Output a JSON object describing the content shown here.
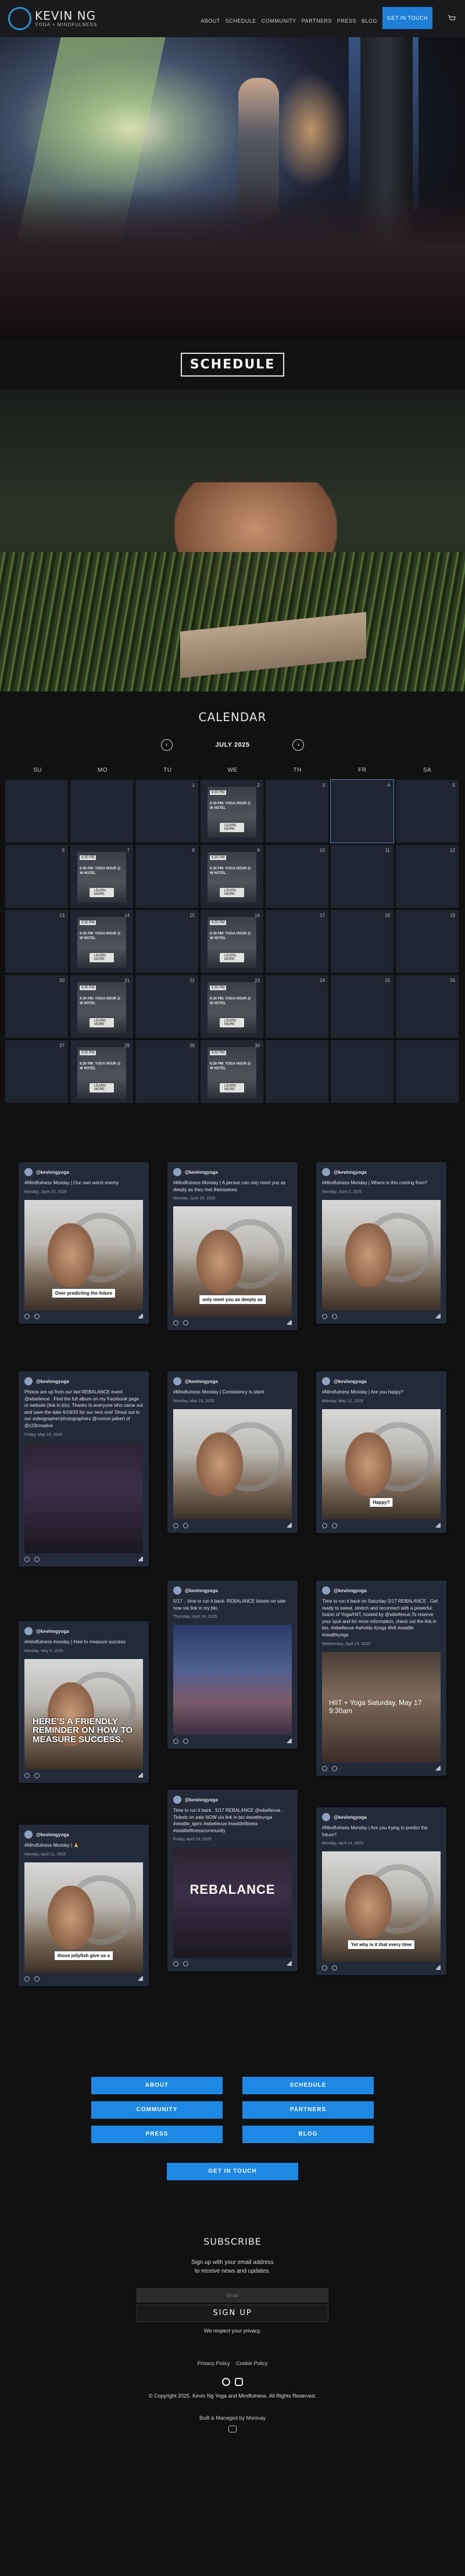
{
  "brand": {
    "name": "KEVIN NG",
    "tagline": "YOGA + MINDFULNESS"
  },
  "nav": {
    "items": [
      "ABOUT",
      "SCHEDULE",
      "COMMUNITY",
      "PARTNERS",
      "PRESS",
      "BLOG"
    ],
    "cta": "GET IN TOUCH",
    "extra_icon": "cart-icon"
  },
  "schedule_button": "SCHEDULE",
  "calendar": {
    "title": "CALENDAR",
    "month": "JULY 2025",
    "prev_icon": "chevron-left-icon",
    "next_icon": "chevron-right-icon",
    "weekdays": [
      "SU",
      "MO",
      "TU",
      "WE",
      "TH",
      "FR",
      "SA"
    ],
    "today_index": 5,
    "days": [
      {
        "n": "",
        "ev": false
      },
      {
        "n": "",
        "ev": false
      },
      {
        "n": "1",
        "ev": false
      },
      {
        "n": "2",
        "ev": true
      },
      {
        "n": "3",
        "ev": false
      },
      {
        "n": "4",
        "ev": false
      },
      {
        "n": "5",
        "ev": false
      },
      {
        "n": "6",
        "ev": false
      },
      {
        "n": "7",
        "ev": true
      },
      {
        "n": "8",
        "ev": false
      },
      {
        "n": "9",
        "ev": true
      },
      {
        "n": "10",
        "ev": false
      },
      {
        "n": "11",
        "ev": false
      },
      {
        "n": "12",
        "ev": false
      },
      {
        "n": "13",
        "ev": false
      },
      {
        "n": "14",
        "ev": true
      },
      {
        "n": "15",
        "ev": false
      },
      {
        "n": "16",
        "ev": true
      },
      {
        "n": "17",
        "ev": false
      },
      {
        "n": "18",
        "ev": false
      },
      {
        "n": "19",
        "ev": false
      },
      {
        "n": "20",
        "ev": false
      },
      {
        "n": "21",
        "ev": true
      },
      {
        "n": "22",
        "ev": false
      },
      {
        "n": "23",
        "ev": true
      },
      {
        "n": "24",
        "ev": false
      },
      {
        "n": "25",
        "ev": false
      },
      {
        "n": "26",
        "ev": false
      },
      {
        "n": "27",
        "ev": false
      },
      {
        "n": "28",
        "ev": true
      },
      {
        "n": "29",
        "ev": false
      },
      {
        "n": "30",
        "ev": true
      },
      {
        "n": "",
        "ev": false
      },
      {
        "n": "",
        "ev": false
      },
      {
        "n": "",
        "ev": false
      }
    ],
    "event_tag": "6:30 PM",
    "event_text": "6:30 PM: YOGA HOUR @ W HOTEL",
    "event_pill": "LEARN MORE"
  },
  "feed": {
    "handle": "@kevinngyoga",
    "posts": [
      {
        "text": "#Mindfulness Monday | Our own worst enemy",
        "date": "Monday, June 23, 2025",
        "img": "face",
        "cap": "Over predicting the future"
      },
      {
        "text": "#Mindfulness Monday | A person can only meet you as deeply as they met themselves",
        "date": "Monday, June 16, 2025",
        "img": "face",
        "cap": "only meet you as deeply as"
      },
      {
        "text": "#Mindfulness Monday | Where is this coming from?",
        "date": "Monday, June 2, 2025",
        "img": "face",
        "cap": ""
      },
      {
        "text": "Photos are up from our last REBALANCE event @wbellevue . Find the full album on my Facebook page or website (link in bio). Thanks to everyone who came out and save the date 6/19/25 for our next one! Shout out to our videographer/photographers @connor.jalbert of @c33creative",
        "date": "Friday, May 23, 2025",
        "img": "dark",
        "cap": ""
      },
      {
        "text": "#Mindfulness Monday | Consistency is silent",
        "date": "Monday, May 19, 2025",
        "img": "face",
        "cap": ""
      },
      {
        "text": "#Mindfulness Monday | Are you happy?",
        "date": "Monday, May 12, 2025",
        "img": "face",
        "cap": "Happy?"
      },
      {
        "text": "#mindfulness monday | How to measure success",
        "date": "Monday, May 5, 2025",
        "img": "face",
        "cap": "",
        "big": "HERE'S A FRIENDLY REMINDER ON HOW TO MEASURE SUCCESS."
      },
      {
        "text": "5/17 .. time to run it back. REBALANCE tickets on sale now via link in my bio.",
        "date": "Thursday, April 24, 2025",
        "img": "room",
        "cap": ""
      },
      {
        "text": "Time to run it back on Saturday 5/17 REBALANCE . Get ready to sweat, stretch and reconnect with a powerful fusion of Yoga/HIIT, hosted by @wbellevue.To reserve your spot and for more information, check out the link in bio. #wbellevue #wholds #yoga #hiit #seattle #seattleyoga",
        "date": "Wednesday, April 23, 2025",
        "img": "promo",
        "cap": "",
        "promo": "HIIT + Yoga Saturday, May 17 9:30am"
      },
      {
        "text": "#Mindfulness Monday | 🙏",
        "date": "Monday, April 21, 2025",
        "img": "face",
        "cap": "those jellyfish give us a"
      },
      {
        "text": "Time to run it back.. 5/17 REBALANCE @wbellevue . Tickets on sale NOW via link in bio #seattleyoga #seattle_igers #wbellevue #seattlefitness #seattlefitnesscommunity",
        "date": "Friday, April 18, 2025",
        "img": "dark",
        "cap": "",
        "big": "REBALANCE"
      },
      {
        "text": "#Mindfulness Monday | Are you trying to predict the future?",
        "date": "Monday, April 14, 2025",
        "img": "face",
        "cap": "Yet why is it that every time"
      }
    ]
  },
  "footer": {
    "links": [
      "ABOUT",
      "SCHEDULE",
      "COMMUNITY",
      "PARTNERS",
      "PRESS",
      "BLOG"
    ],
    "cta": "GET IN TOUCH",
    "subscribe_title": "SUBSCRIBE",
    "subscribe_text1": "Sign up with your email address",
    "subscribe_text2": "to receive news and updates.",
    "email_placeholder": "Email",
    "signup_label": "SIGN UP",
    "privacy": "We respect your privacy.",
    "privacy_policy": "Privacy Policy",
    "cookie_policy": "Cookie Policy",
    "copyright": "© Copyright 2025. Kevin Ng Yoga and Mindfulness. All Rights Reserved.",
    "built": "Built & Managed by Monivay"
  }
}
